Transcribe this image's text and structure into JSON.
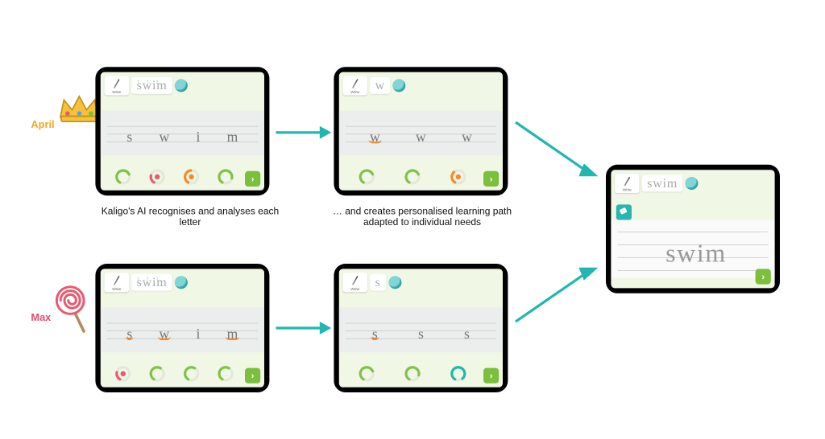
{
  "students": {
    "april": {
      "label": "April",
      "color": "#f5a623",
      "badge": "crown-icon"
    },
    "max": {
      "label": "Max",
      "color": "#e74c6f",
      "badge": "lollipop-icon"
    }
  },
  "captions": {
    "step1": "Kaligo's AI recognises and analyses each letter",
    "step2": "… and creates personalised learning path adapted to individual needs"
  },
  "word": "swim",
  "tablets": {
    "april_step1": {
      "chip": "Write",
      "target": "swim",
      "letters": [
        "s",
        "w",
        "i",
        "m"
      ],
      "orange_indices": [],
      "gauges": [
        {
          "color": "#7fc24a",
          "fill": 0.6
        },
        {
          "color": "#e85a6f",
          "fill": 0.2,
          "center": true
        },
        {
          "color": "#f28a2e",
          "fill": 0.4,
          "center": true
        },
        {
          "color": "#7fc24a",
          "fill": 0.7
        }
      ]
    },
    "april_step2": {
      "chip": "Write",
      "target": "w",
      "letters": [
        "w",
        "w",
        "w"
      ],
      "orange_indices": [
        0
      ],
      "gauges": [
        {
          "color": "#7fc24a",
          "fill": 0.6
        },
        {
          "color": "#7fc24a",
          "fill": 0.6
        },
        {
          "color": "#f28a2e",
          "fill": 0.3,
          "center": true
        }
      ]
    },
    "max_step1": {
      "chip": "Write",
      "target": "swim",
      "letters": [
        "s",
        "w",
        "i",
        "m"
      ],
      "orange_indices": [
        0,
        1,
        3
      ],
      "gauges": [
        {
          "color": "#e85a6f",
          "fill": 0.2,
          "center": true
        },
        {
          "color": "#7fc24a",
          "fill": 0.5
        },
        {
          "color": "#7fc24a",
          "fill": 0.5
        },
        {
          "color": "#7fc24a",
          "fill": 0.5
        }
      ]
    },
    "max_step2": {
      "chip": "Write",
      "target": "s",
      "letters": [
        "s",
        "s",
        "s"
      ],
      "orange_indices": [
        0
      ],
      "gauges": [
        {
          "color": "#7fc24a",
          "fill": 0.6
        },
        {
          "color": "#7fc24a",
          "fill": 0.7
        },
        {
          "color": "#1fb7b0",
          "fill": 0.8
        }
      ]
    },
    "final": {
      "chip": "Write",
      "target": "swim",
      "cursive": "swim"
    }
  },
  "ui": {
    "next_glyph": "›"
  }
}
